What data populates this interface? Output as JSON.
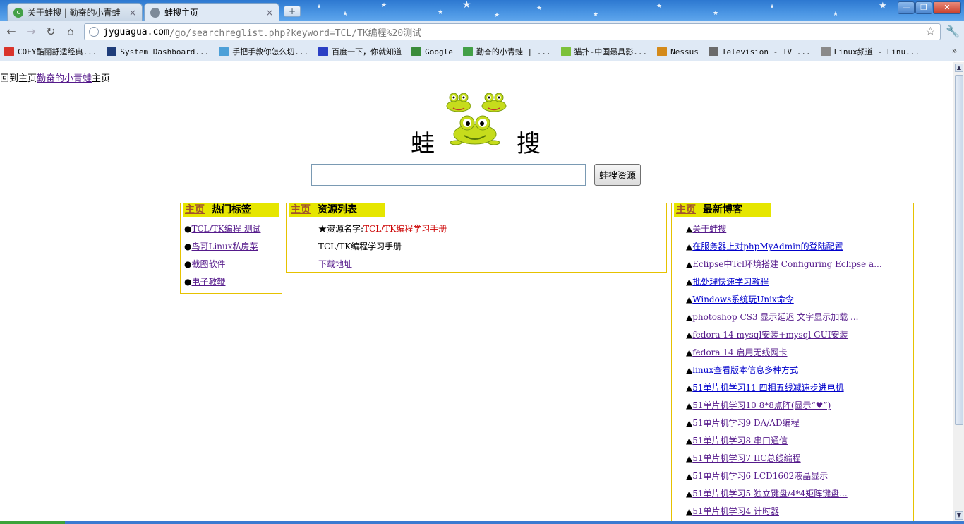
{
  "tabs": [
    {
      "title": "关于蛙搜 | 勤奋的小青蛙",
      "close": "×"
    },
    {
      "title": "蛙搜主页",
      "close": "×"
    }
  ],
  "window_controls": {
    "minimize": "—",
    "restore": "❐",
    "close": "✕"
  },
  "new_tab": "+",
  "nav": {
    "back": "←",
    "forward": "→",
    "reload": "↻",
    "home": "⌂"
  },
  "address": {
    "host": "jyguagua.com",
    "rest": "/go/searchreglist.php?keyword=TCL/TK编程%20测试"
  },
  "bookmarks": [
    {
      "label": "COEY酷丽舒适经典...",
      "icon_color": "#d9342b"
    },
    {
      "label": "System Dashboard...",
      "icon_color": "#1f3d7a"
    },
    {
      "label": "手把手教你怎么切...",
      "icon_color": "#4da0d8"
    },
    {
      "label": "百度一下，你就知道",
      "icon_color": "#2b3fc4"
    },
    {
      "label": "Google",
      "icon_color": "#3b8c3b"
    },
    {
      "label": "勤奋的小青蛙 | ...",
      "icon_color": "#43a047"
    },
    {
      "label": "猫扑-中国最具影...",
      "icon_color": "#7cc13a"
    },
    {
      "label": "Nessus",
      "icon_color": "#d48a1a"
    },
    {
      "label": "Television - TV ...",
      "icon_color": "#6b6b6b"
    },
    {
      "label": "Linux频道 - Linu...",
      "icon_color": "#8a8a8a"
    }
  ],
  "bookmarks_more": "»",
  "page": {
    "back_prefix": "回到主页",
    "back_link": "勤奋的小青蛙",
    "back_suffix": "主页",
    "logo_left": "蛙",
    "logo_right": "搜",
    "search_value": "",
    "search_button": "蛙搜资源"
  },
  "hot_tags": {
    "home": "主页",
    "title": "热门标签",
    "bullet": "●",
    "items": [
      "TCL/TK编程 测试",
      "鸟哥Linux私房菜",
      "截图软件",
      "电子教鞭"
    ]
  },
  "resources": {
    "home": "主页",
    "title": "资源列表",
    "star": "★",
    "name_label": "资源名字:",
    "name_value": "TCL/TK编程学习手册",
    "desc": "TCL/TK编程学习手册",
    "download": "下载地址"
  },
  "blogs": {
    "home": "主页",
    "title": "最新博客",
    "bullet": "▲",
    "items": [
      "关于蛙搜",
      "在服务器上对phpMyAdmin的登陆配置",
      "Eclipse中Tcl环境搭建 Configuring Eclipse a...",
      "批处理快速学习教程",
      "Windows系统玩Unix命令",
      "photoshop CS3 显示延迟 文字显示加载    ...",
      "fedora 14 mysql安装+mysql GUI安装",
      "fedora 14 启用无线网卡",
      "linux查看版本信息多种方式",
      "51单片机学习11 四相五线减速步进电机",
      "51单片机学习10 8*8点阵(显示“♥”)",
      "51单片机学习9 DA/AD编程",
      "51单片机学习8 串口通信",
      "51单片机学习7 IIC总线编程",
      "51单片机学习6 LCD1602液晶显示",
      "51单片机学习5 独立键盘/4*4矩阵键盘...",
      "51单片机学习4 计时器"
    ]
  }
}
